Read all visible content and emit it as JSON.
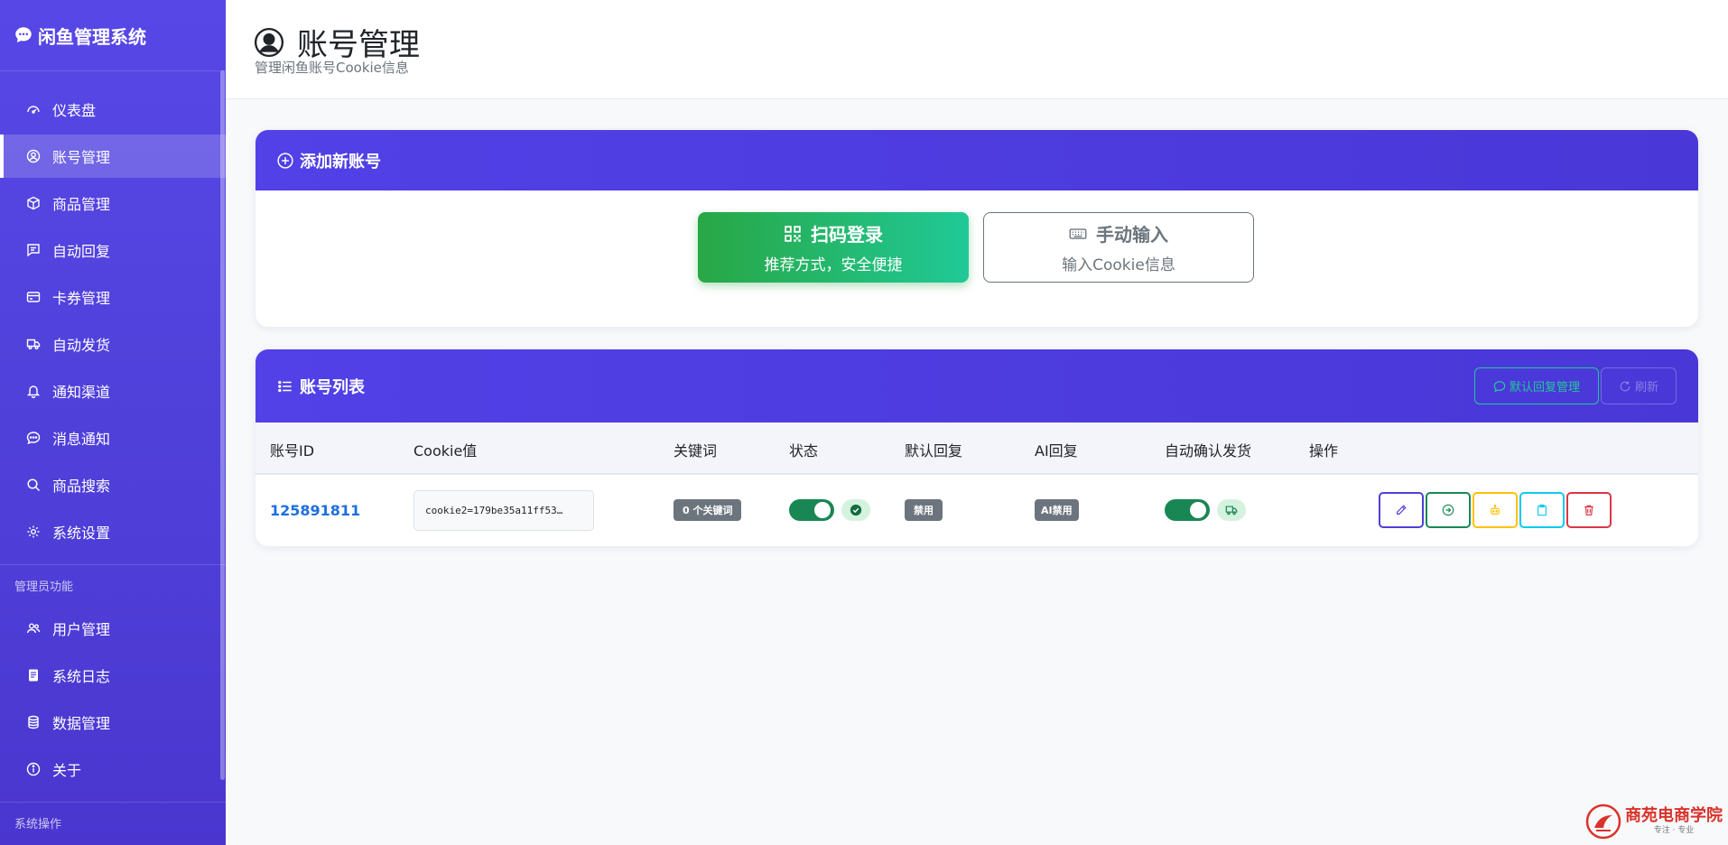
{
  "app": {
    "title": "闲鱼管理系统"
  },
  "colors": {
    "sidebar": "#5747e6",
    "primary": "#4f3fd8",
    "success": "#198754",
    "link": "#1e6fe0"
  },
  "sidebar": {
    "items": [
      {
        "label": "仪表盘",
        "icon": "dashboard-icon"
      },
      {
        "label": "账号管理",
        "icon": "user-circle-icon",
        "active": true
      },
      {
        "label": "商品管理",
        "icon": "box-icon"
      },
      {
        "label": "自动回复",
        "icon": "message-icon"
      },
      {
        "label": "卡券管理",
        "icon": "card-icon"
      },
      {
        "label": "自动发货",
        "icon": "truck-icon"
      },
      {
        "label": "通知渠道",
        "icon": "bell-icon"
      },
      {
        "label": "消息通知",
        "icon": "chat-dots-icon"
      },
      {
        "label": "商品搜索",
        "icon": "search-icon"
      },
      {
        "label": "系统设置",
        "icon": "gear-icon"
      }
    ],
    "admin_section": "管理员功能",
    "admin_items": [
      {
        "label": "用户管理",
        "icon": "users-icon"
      },
      {
        "label": "系统日志",
        "icon": "log-icon"
      },
      {
        "label": "数据管理",
        "icon": "database-icon"
      },
      {
        "label": "关于",
        "icon": "info-icon"
      }
    ],
    "ops_section": "系统操作"
  },
  "header": {
    "title": "账号管理",
    "subtitle": "管理闲鱼账号Cookie信息"
  },
  "add_card": {
    "title": "添加新账号",
    "qr_button": {
      "label": "扫码登录",
      "sub": "推荐方式，安全便捷"
    },
    "manual_button": {
      "label": "手动输入",
      "sub": "输入Cookie信息"
    }
  },
  "list_card": {
    "title": "账号列表",
    "default_reply_button": "默认回复管理",
    "refresh_button": "刷新",
    "columns": [
      "账号ID",
      "Cookie值",
      "关键词",
      "状态",
      "默认回复",
      "AI回复",
      "自动确认发货",
      "操作"
    ],
    "rows": [
      {
        "id": "125891811",
        "cookie": "cookie2=179be35a11ff53…",
        "keywords": "0 个关键词",
        "status_enabled": true,
        "default_reply": "禁用",
        "ai_reply": "AI禁用",
        "auto_confirm_enabled": true
      }
    ]
  },
  "watermark": {
    "main": "商苑电商学院",
    "sub": "专注 · 专业"
  }
}
